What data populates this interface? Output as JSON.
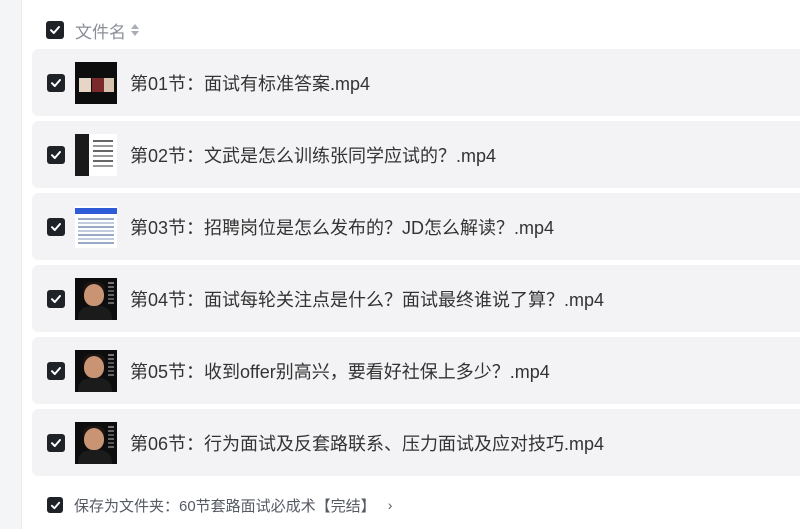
{
  "header": {
    "column_label": "文件名",
    "sort_icon": "sort-icon",
    "select_all_checked": true
  },
  "files": [
    {
      "name": "第01节：面试有标准答案.mp4",
      "checked": true,
      "thumbnail": "video-thumbnail"
    },
    {
      "name": "第02节：文武是怎么训练张同学应试的？.mp4",
      "checked": true,
      "thumbnail": "video-thumbnail"
    },
    {
      "name": "第03节：招聘岗位是怎么发布的？JD怎么解读？.mp4",
      "checked": true,
      "thumbnail": "video-thumbnail"
    },
    {
      "name": "第04节：面试每轮关注点是什么？面试最终谁说了算？.mp4",
      "checked": true,
      "thumbnail": "video-thumbnail"
    },
    {
      "name": "第05节：收到offer别高兴，要看好社保上多少？.mp4",
      "checked": true,
      "thumbnail": "video-thumbnail"
    },
    {
      "name": "第06节：行为面试及反套路联系、压力面试及应对技巧.mp4",
      "checked": true,
      "thumbnail": "video-thumbnail"
    }
  ],
  "footer": {
    "save_as_folder": "保存为文件夹：60节套路面试必成术【完结】",
    "checked": true,
    "chevron": "›"
  },
  "colors": {
    "checkbox": "#1f2227",
    "row_background": "#f3f3f5",
    "header_text": "#8a8e97",
    "file_text": "#333333"
  }
}
